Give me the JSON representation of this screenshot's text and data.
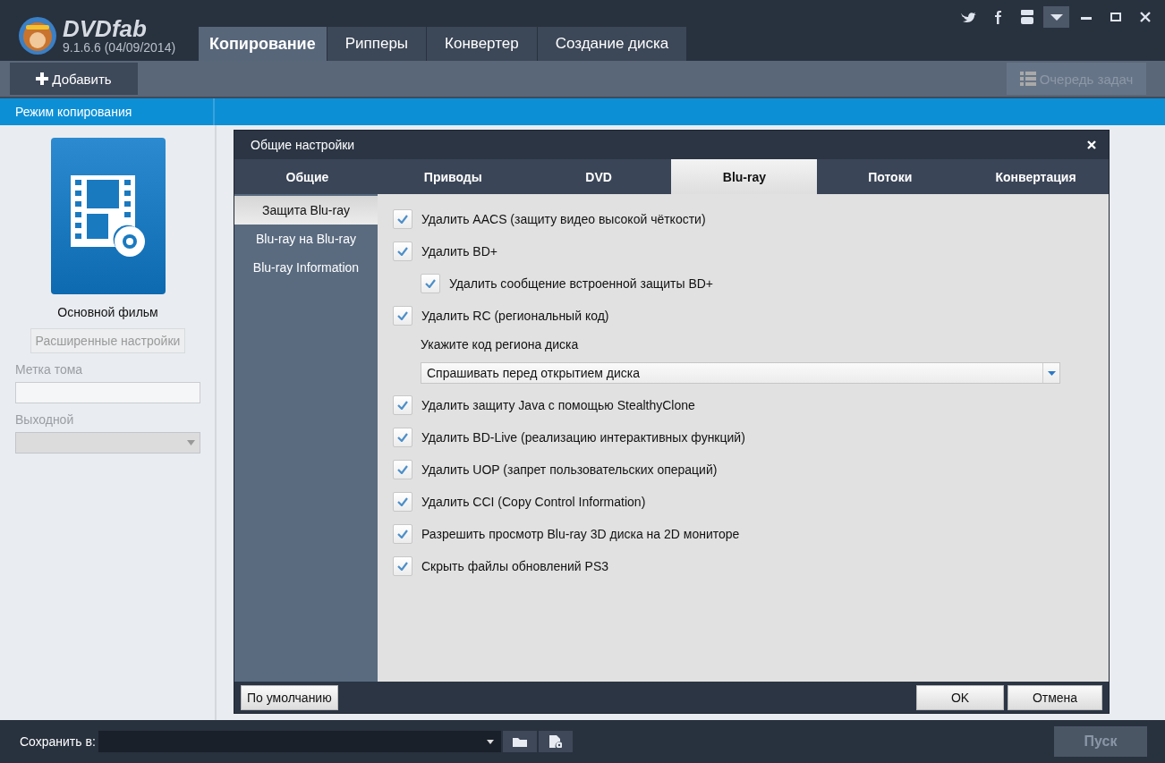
{
  "app": {
    "logo_text": "DVDfab",
    "version": "9.1.6.6 (04/09/2014)"
  },
  "main_tabs": [
    {
      "label": "Копирование",
      "selected": true
    },
    {
      "label": "Рипперы",
      "selected": false
    },
    {
      "label": "Конвертер",
      "selected": false
    },
    {
      "label": "Создание диска",
      "selected": false
    }
  ],
  "toolbar": {
    "add_button": "Добавить",
    "queue_button": {
      "label": "Очередь задач",
      "disabled": true
    }
  },
  "mode_bar": {
    "title": "Режим копирования"
  },
  "left_panel": {
    "mode_label": "Основной фильм",
    "advanced_button": {
      "label": "Расширенные настройки",
      "disabled": true
    },
    "volume_label": "Метка тома",
    "output_label": "Выходной"
  },
  "dialog": {
    "title": "Общие настройки",
    "tabs": [
      {
        "label": "Общие",
        "selected": false
      },
      {
        "label": "Приводы",
        "selected": false
      },
      {
        "label": "DVD",
        "selected": false
      },
      {
        "label": "Blu-ray",
        "selected": true
      },
      {
        "label": "Потоки",
        "selected": false
      },
      {
        "label": "Конвертация",
        "selected": false
      }
    ],
    "sidebar": [
      {
        "label": "Защита Blu-ray",
        "selected": true
      },
      {
        "label": "Blu-ray на Blu-ray",
        "selected": false
      },
      {
        "label": "Blu-ray Information",
        "selected": false
      }
    ],
    "options": [
      {
        "kind": "checkbox",
        "label": "Удалить AACS (защиту видео высокой чёткости)",
        "checked": true
      },
      {
        "kind": "checkbox",
        "label": "Удалить BD+",
        "checked": true,
        "children": [
          {
            "kind": "checkbox",
            "label": "Удалить сообщение встроенной защиты BD+",
            "checked": true
          }
        ]
      },
      {
        "kind": "checkbox",
        "label": "Удалить RC (региональный код)",
        "checked": true,
        "children": [
          {
            "kind": "label",
            "label": "Укажите код региона диска"
          },
          {
            "kind": "dropdown",
            "value": "Спрашивать перед открытием диска"
          }
        ]
      },
      {
        "kind": "checkbox",
        "label": "Удалить защиту Java с помощью StealthyClone",
        "checked": true
      },
      {
        "kind": "checkbox",
        "label": "Удалить BD-Live (реализацию интерактивных функций)",
        "checked": true
      },
      {
        "kind": "checkbox",
        "label": "Удалить UOP (запрет пользовательских операций)",
        "checked": true
      },
      {
        "kind": "checkbox",
        "label": "Удалить CCI (Copy Control Information)",
        "checked": true
      },
      {
        "kind": "checkbox",
        "label": "Разрешить просмотр Blu-ray 3D диска на 2D мониторе",
        "checked": true
      },
      {
        "kind": "checkbox",
        "label": "Скрыть файлы обновлений PS3",
        "checked": true
      }
    ],
    "buttons": {
      "default": "По умолчанию",
      "ok": "OK",
      "cancel": "Отмена"
    }
  },
  "bottom_bar": {
    "save_label": "Сохранить в:",
    "start_button": {
      "label": "Пуск",
      "disabled": true
    }
  }
}
